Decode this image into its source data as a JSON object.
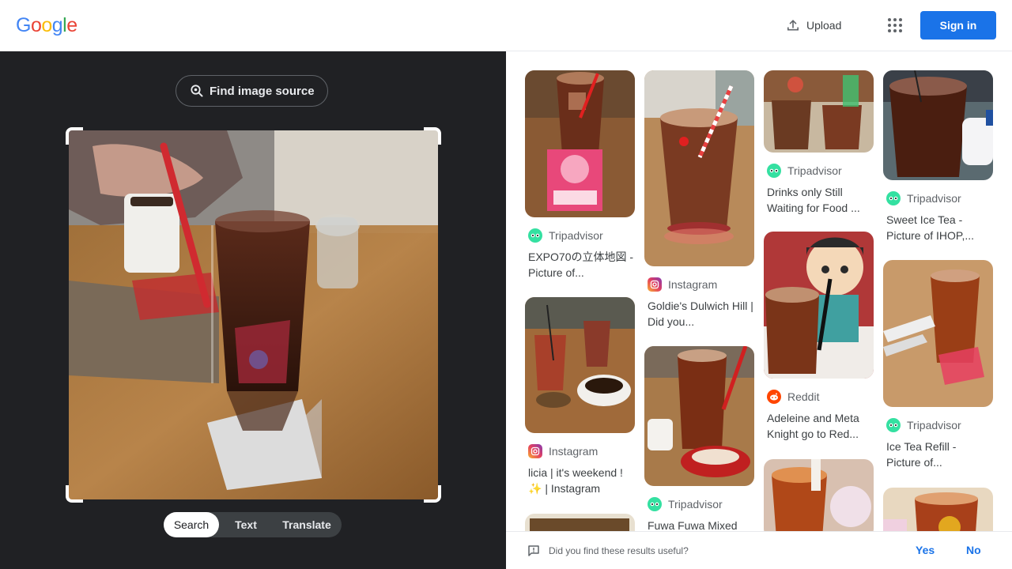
{
  "header": {
    "logo_letters": [
      {
        "ch": "G",
        "color": "#4285f4"
      },
      {
        "ch": "o",
        "color": "#ea4335"
      },
      {
        "ch": "o",
        "color": "#fbbc05"
      },
      {
        "ch": "g",
        "color": "#4285f4"
      },
      {
        "ch": "l",
        "color": "#34a853"
      },
      {
        "ch": "e",
        "color": "#ea4335"
      }
    ],
    "upload_label": "Upload",
    "signin_label": "Sign in"
  },
  "lens": {
    "find_source_label": "Find image source",
    "modes": [
      {
        "label": "Search",
        "active": true
      },
      {
        "label": "Text",
        "active": false
      },
      {
        "label": "Translate",
        "active": false
      }
    ]
  },
  "results": {
    "columns": [
      [
        {
          "source": "Tripadvisor",
          "source_icon": "tripadvisor-icon",
          "title": "EXPO70の立体地図 - Picture of..."
        },
        {
          "source": "Instagram",
          "source_icon": "instagram-icon",
          "title": "licia | it's weekend ! ✨ | Instagram"
        }
      ],
      [
        {
          "source": "Instagram",
          "source_icon": "instagram-icon",
          "title": "Goldie's Dulwich Hill | Did you..."
        },
        {
          "source": "Tripadvisor",
          "source_icon": "tripadvisor-icon",
          "title": "Fuwa Fuwa Mixed"
        }
      ],
      [
        {
          "source": "Tripadvisor",
          "source_icon": "tripadvisor-icon",
          "title": "Drinks only Still Waiting for Food ..."
        },
        {
          "source": "Reddit",
          "source_icon": "reddit-icon",
          "title": "Adeleine and Meta Knight go to Red..."
        }
      ],
      [
        {
          "source": "Tripadvisor",
          "source_icon": "tripadvisor-icon",
          "title": "Sweet Ice Tea - Picture of IHOP,..."
        },
        {
          "source": "Tripadvisor",
          "source_icon": "tripadvisor-icon",
          "title": "Ice Tea Refill - Picture of..."
        }
      ]
    ]
  },
  "feedback": {
    "question": "Did you find these results useful?",
    "yes": "Yes",
    "no": "No"
  }
}
